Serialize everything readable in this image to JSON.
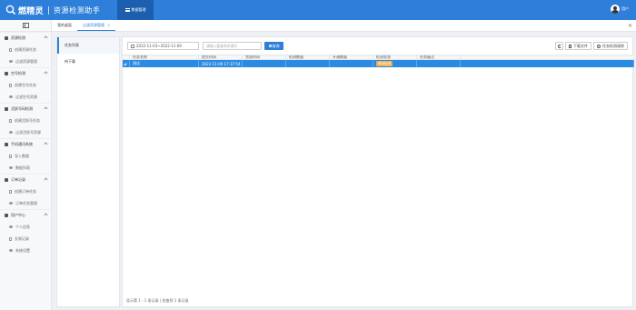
{
  "header": {
    "logo_name": "燃精灵",
    "logo_subtitle": "资源检测助手",
    "nav_label": "数据管理",
    "user_name": "用户"
  },
  "sidebar": {
    "groups": [
      {
        "label": "资源检测",
        "items": [
          "创建资源任务",
          "过滤资源管理"
        ]
      },
      {
        "label": "空号检测",
        "items": [
          "创建空号任务",
          "过滤空号资源"
        ]
      },
      {
        "label": "活跃号码检测",
        "items": [
          "创建活跃号任务",
          "过滤活跃号资源"
        ]
      },
      {
        "label": "手机通讯系统",
        "items": [
          "导入数据",
          "数据列表"
        ]
      },
      {
        "label": "订单记录",
        "items": [
          "创建订单任务",
          "订单任务管理"
        ]
      },
      {
        "label": "用户中心",
        "items": [
          "个人信息",
          "交易记录",
          "系统设置"
        ]
      }
    ]
  },
  "tabs": [
    {
      "label": "我的桌面"
    },
    {
      "label": "过滤资源管理"
    }
  ],
  "tab_close_symbol": "×",
  "inner_nav": [
    "任务列表",
    "待下载"
  ],
  "toolbar": {
    "date_range": "2022-11-03~2022-11-09",
    "search_placeholder": "请输入要查询关键字",
    "query_label": "查询",
    "download_label": "下载文件",
    "clear_label": "任务检测清除"
  },
  "table": {
    "headers": [
      "任务名称",
      "提交时间",
      "完成时间",
      "检测数量",
      "开通数量",
      "检测状态",
      "任务备注"
    ],
    "rows": [
      {
        "name": "测试",
        "submit_time": "2022-11-09 17:37:54",
        "finish_time": "",
        "detect_count": "",
        "open_count": "",
        "status": "等待检测",
        "remark": ""
      }
    ]
  },
  "footer": "显示第 1 - 1 条记录 | 检查到 1 条记录",
  "colors": {
    "primary": "#2e7fd9",
    "selected_row": "#2b8be3",
    "badge": "#f0ad4e"
  },
  "icons": [
    "logo-icon",
    "menu-icon",
    "grid-icon",
    "calendar-icon",
    "search-icon",
    "refresh-icon",
    "file-icon",
    "clear-icon",
    "check-icon"
  ]
}
